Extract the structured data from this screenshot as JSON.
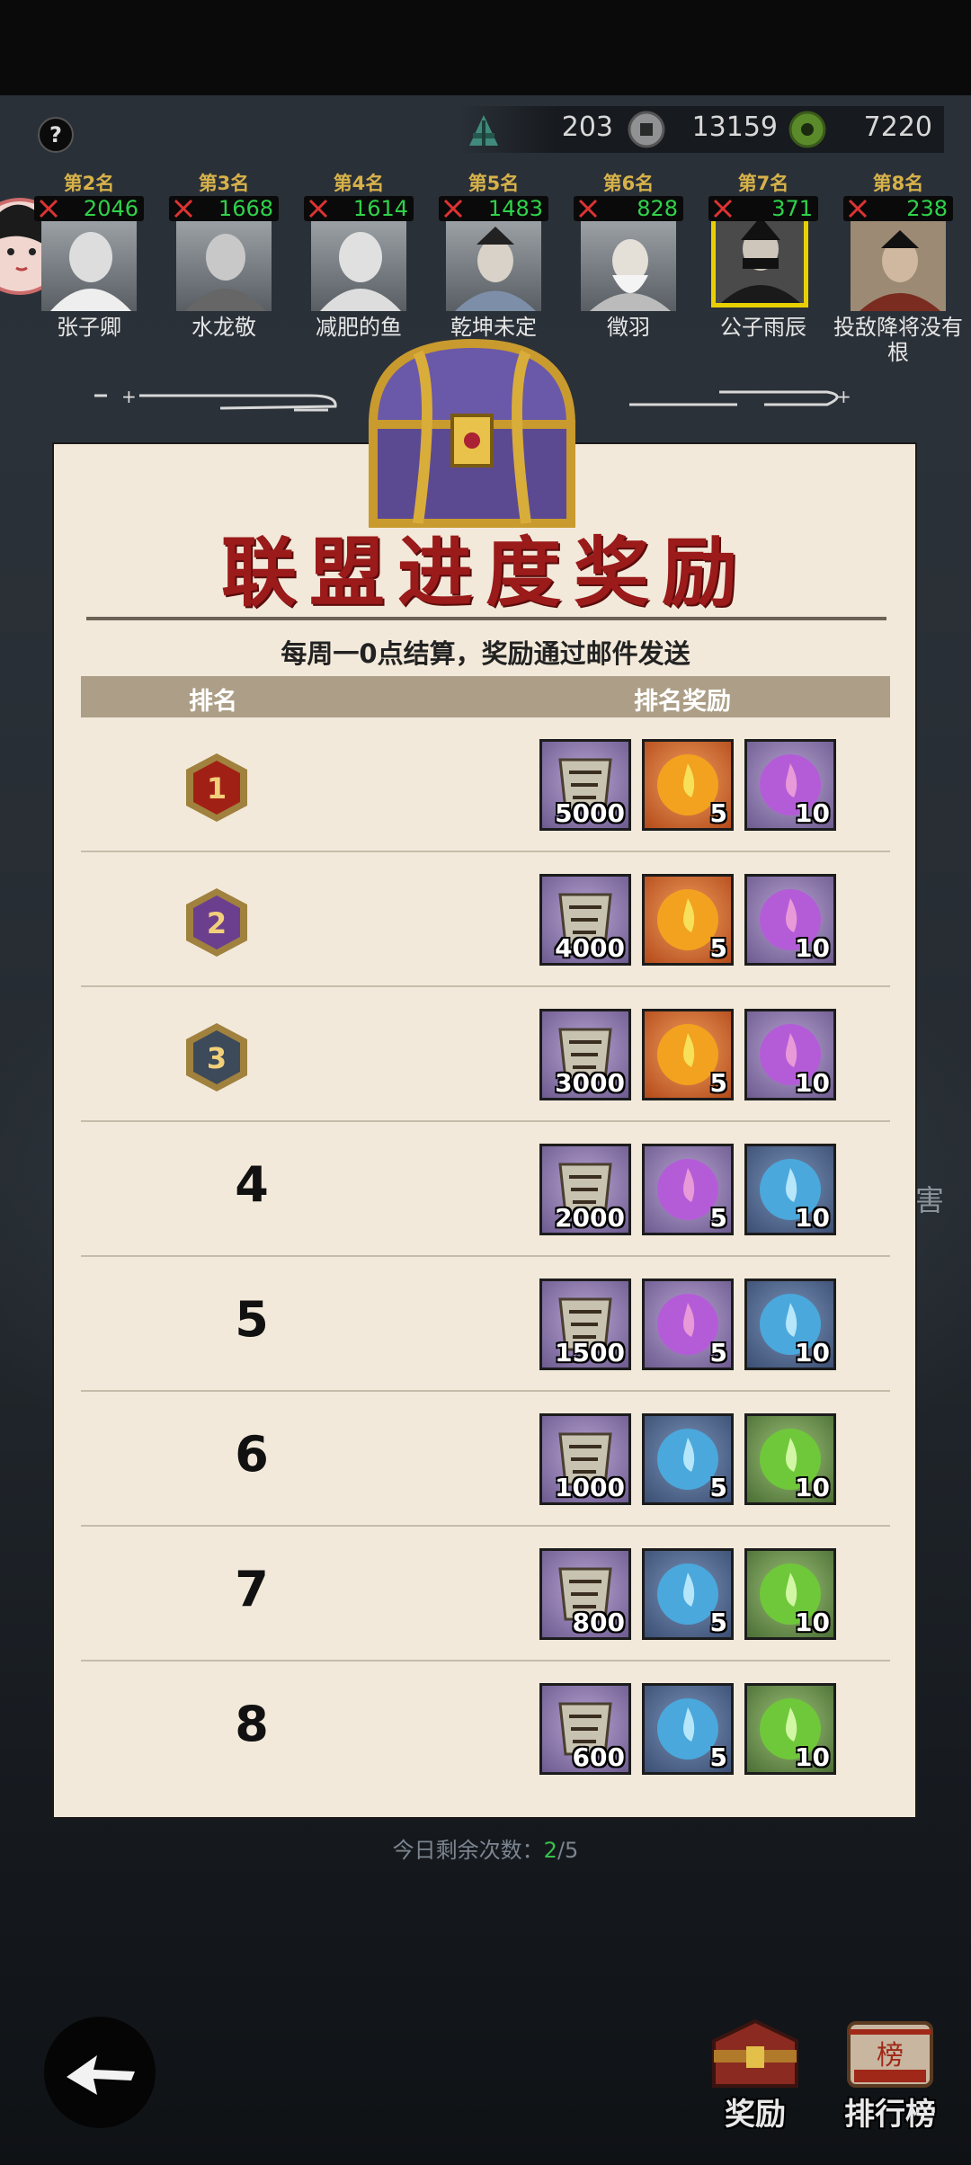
{
  "topbar": {
    "help_label": "?",
    "resources": [
      {
        "icon": "banner-flag-icon",
        "value": "203"
      },
      {
        "icon": "copper-coin-icon",
        "value": "13159"
      },
      {
        "icon": "jade-coin-icon",
        "value": "7220"
      }
    ]
  },
  "ranking_strip": [
    {
      "rank": "第2名",
      "score": "2046",
      "name": "张子卿"
    },
    {
      "rank": "第3名",
      "score": "1668",
      "name": "水龙敬"
    },
    {
      "rank": "第4名",
      "score": "1614",
      "name": "减肥的鱼"
    },
    {
      "rank": "第5名",
      "score": "1483",
      "name": "乾坤未定"
    },
    {
      "rank": "第6名",
      "score": "828",
      "name": "徵羽"
    },
    {
      "rank": "第7名",
      "score": "371",
      "name": "公子雨辰",
      "highlighted": true
    },
    {
      "rank": "第8名",
      "score": "238",
      "name": "投敌降将没有根"
    }
  ],
  "modal": {
    "title": "联盟进度奖励",
    "subtitle": "每周一0点结算，奖励通过邮件发送",
    "col_rank": "排名",
    "col_reward": "排名奖励",
    "rows": [
      {
        "rank": "1",
        "badge": "red-hex-badge-icon",
        "items": [
          {
            "type": "scroll-token-icon",
            "qty": "5000",
            "bg": "purple"
          },
          {
            "type": "fire-orb-orange-icon",
            "qty": "5",
            "bg": "orange"
          },
          {
            "type": "fire-orb-purple-icon",
            "qty": "10",
            "bg": "purple"
          }
        ]
      },
      {
        "rank": "2",
        "badge": "purple-hex-badge-icon",
        "items": [
          {
            "type": "scroll-token-icon",
            "qty": "4000",
            "bg": "purple"
          },
          {
            "type": "fire-orb-orange-icon",
            "qty": "5",
            "bg": "orange"
          },
          {
            "type": "fire-orb-purple-icon",
            "qty": "10",
            "bg": "purple"
          }
        ]
      },
      {
        "rank": "3",
        "badge": "blue-hex-badge-icon",
        "items": [
          {
            "type": "scroll-token-icon",
            "qty": "3000",
            "bg": "purple"
          },
          {
            "type": "fire-orb-orange-icon",
            "qty": "5",
            "bg": "orange"
          },
          {
            "type": "fire-orb-purple-icon",
            "qty": "10",
            "bg": "purple"
          }
        ]
      },
      {
        "rank": "4",
        "items": [
          {
            "type": "scroll-token-icon",
            "qty": "2000",
            "bg": "purple"
          },
          {
            "type": "fire-orb-purple-icon",
            "qty": "5",
            "bg": "purple"
          },
          {
            "type": "fire-orb-blue-icon",
            "qty": "10",
            "bg": "blue"
          }
        ]
      },
      {
        "rank": "5",
        "items": [
          {
            "type": "scroll-token-icon",
            "qty": "1500",
            "bg": "purple"
          },
          {
            "type": "fire-orb-purple-icon",
            "qty": "5",
            "bg": "purple"
          },
          {
            "type": "fire-orb-blue-icon",
            "qty": "10",
            "bg": "blue"
          }
        ]
      },
      {
        "rank": "6",
        "items": [
          {
            "type": "scroll-token-icon",
            "qty": "1000",
            "bg": "purple"
          },
          {
            "type": "fire-orb-blue-icon",
            "qty": "5",
            "bg": "blue"
          },
          {
            "type": "fire-orb-green-icon",
            "qty": "10",
            "bg": "green"
          }
        ]
      },
      {
        "rank": "7",
        "items": [
          {
            "type": "scroll-token-icon",
            "qty": "800",
            "bg": "purple"
          },
          {
            "type": "fire-orb-blue-icon",
            "qty": "5",
            "bg": "blue"
          },
          {
            "type": "fire-orb-green-icon",
            "qty": "10",
            "bg": "green"
          }
        ]
      },
      {
        "rank": "8",
        "items": [
          {
            "type": "scroll-token-icon",
            "qty": "600",
            "bg": "purple"
          },
          {
            "type": "fire-orb-blue-icon",
            "qty": "5",
            "bg": "blue"
          },
          {
            "type": "fire-orb-green-icon",
            "qty": "10",
            "bg": "green"
          }
        ]
      }
    ]
  },
  "below_modal": {
    "remaining_label": "今日剩余次数：",
    "remaining_used": "2",
    "remaining_total": "/5"
  },
  "side_text": "害",
  "bottom_nav": {
    "reward_label": "奖励",
    "leaderboard_label": "排行榜",
    "leaderboard_stamp": "榜"
  },
  "colors": {
    "title_red": "#9b1a1a",
    "score_green": "#2fd24a",
    "rank_gold": "#d7b24a",
    "panel_bg": "#f2e9da",
    "header_bar": "#ad9f87"
  }
}
